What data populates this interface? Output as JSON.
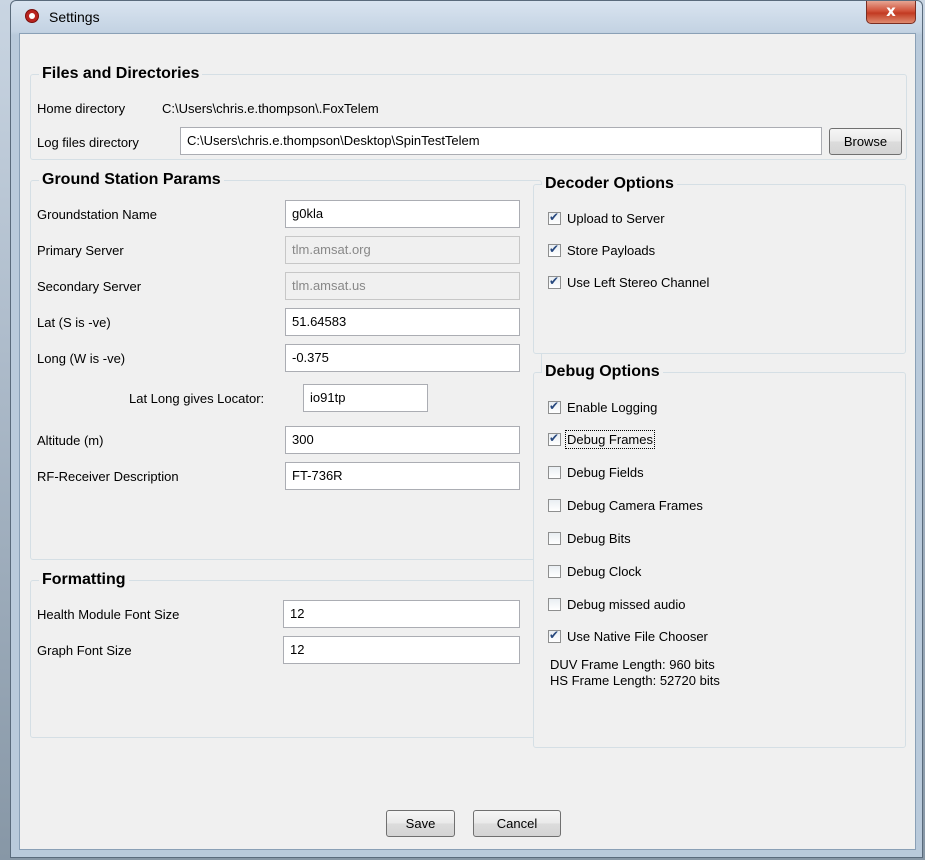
{
  "window": {
    "title": "Settings",
    "close_label": "x"
  },
  "files": {
    "title": "Files and Directories",
    "home_label": "Home directory",
    "home_value": "C:\\Users\\chris.e.thompson\\.FoxTelem",
    "log_label": "Log files directory",
    "log_value": "C:\\Users\\chris.e.thompson\\Desktop\\SpinTestTelem",
    "browse_label": "Browse"
  },
  "ground": {
    "title": "Ground Station Params",
    "name_label": "Groundstation Name",
    "name_value": "g0kla",
    "primary_label": "Primary Server",
    "primary_value": "tlm.amsat.org",
    "secondary_label": "Secondary Server",
    "secondary_value": "tlm.amsat.us",
    "lat_label": "Lat (S is -ve)",
    "lat_value": "51.64583",
    "long_label": "Long (W is -ve)",
    "long_value": "-0.375",
    "locator_label": "Lat Long gives Locator:",
    "locator_value": "io91tp",
    "altitude_label": "Altitude (m)",
    "altitude_value": "300",
    "rf_label": "RF-Receiver Description",
    "rf_value": "FT-736R"
  },
  "formatting": {
    "title": "Formatting",
    "health_label": "Health Module Font Size",
    "health_value": "12",
    "graph_label": "Graph Font Size",
    "graph_value": "12"
  },
  "decoder": {
    "title": "Decoder Options",
    "options": [
      {
        "label": "Upload to Server",
        "checked": true
      },
      {
        "label": "Store Payloads",
        "checked": true
      },
      {
        "label": "Use Left Stereo Channel",
        "checked": true
      }
    ]
  },
  "debug": {
    "title": "Debug Options",
    "options": [
      {
        "label": "Enable Logging",
        "checked": true
      },
      {
        "label": "Debug Frames",
        "checked": true
      },
      {
        "label": "Debug Fields",
        "checked": false
      },
      {
        "label": "Debug Camera Frames",
        "checked": false
      },
      {
        "label": "Debug Bits",
        "checked": false
      },
      {
        "label": "Debug Clock",
        "checked": false
      },
      {
        "label": "Debug missed audio",
        "checked": false
      },
      {
        "label": "Use Native File Chooser",
        "checked": true
      }
    ],
    "duv_length": "DUV Frame Length: 960 bits",
    "hs_length": "HS Frame Length: 52720 bits"
  },
  "buttons": {
    "save": "Save",
    "cancel": "Cancel"
  }
}
